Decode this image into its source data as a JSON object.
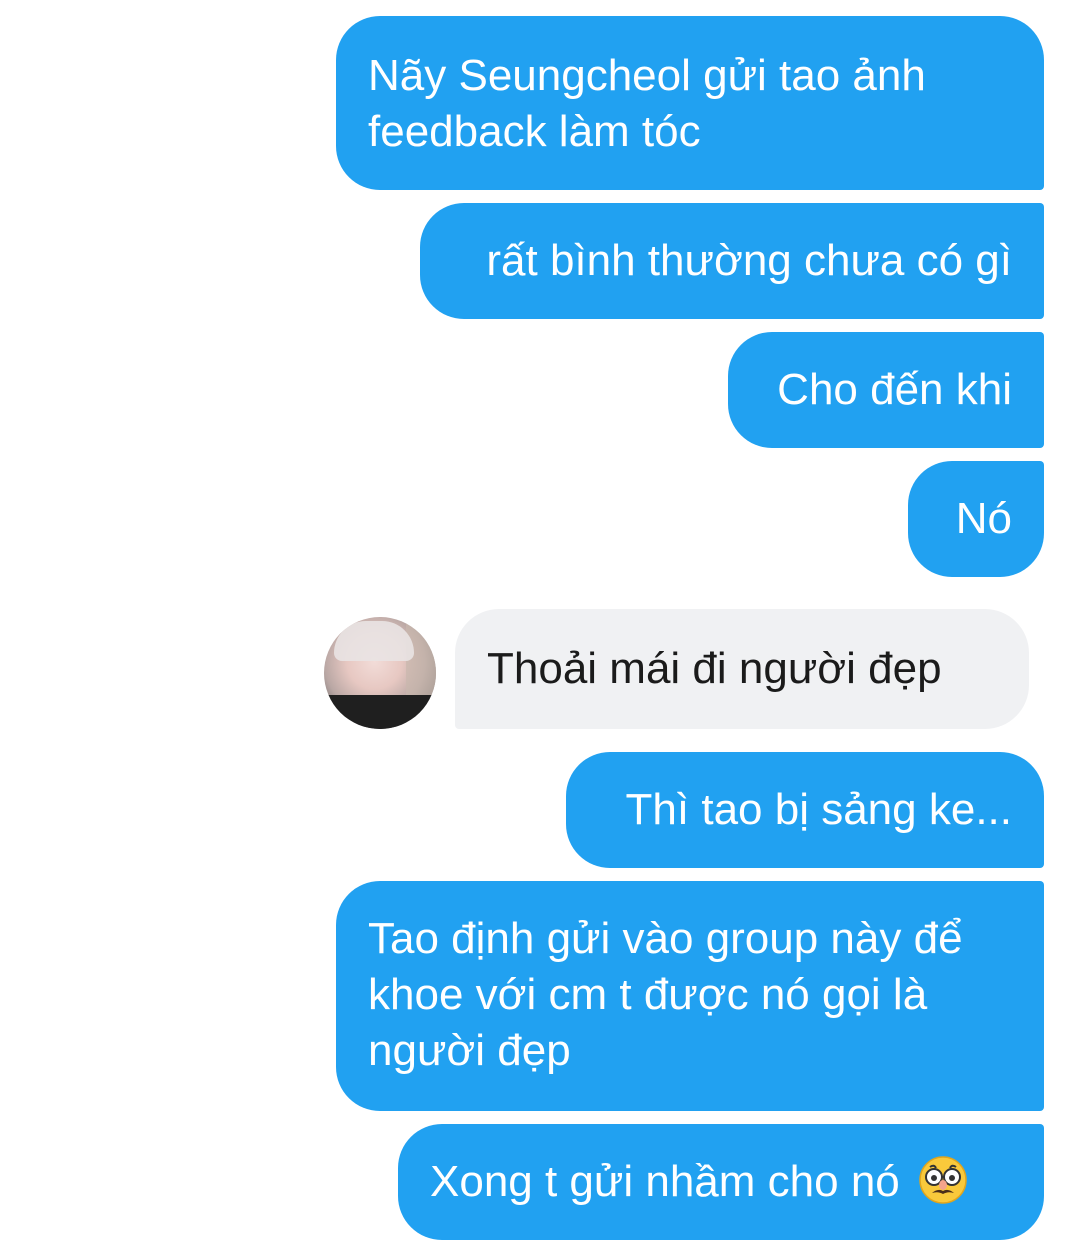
{
  "messages": [
    {
      "id": "m1",
      "direction": "outgoing",
      "text": "Nãy Seungcheol gửi tao ảnh\nfeedback làm tóc"
    },
    {
      "id": "m2",
      "direction": "outgoing",
      "text": "rất bình thường chưa có gì"
    },
    {
      "id": "m3",
      "direction": "outgoing",
      "text": "Cho đến khi"
    },
    {
      "id": "m4",
      "direction": "outgoing",
      "text": "Nó"
    },
    {
      "id": "m5",
      "direction": "incoming",
      "text": "Thoải mái đi người đẹp",
      "sender_avatar": "avatar"
    },
    {
      "id": "m6",
      "direction": "outgoing",
      "text": "Thì tao bị sảng ke..."
    },
    {
      "id": "m7",
      "direction": "outgoing",
      "text": "Tao định gửi vào group này để\nkhoe với cm t được nó gọi là\nngười đẹp"
    },
    {
      "id": "m8",
      "direction": "outgoing",
      "text": "Xong t gửi nhầm cho nó",
      "emoji": "disguised-face-emoji"
    }
  ],
  "colors": {
    "outgoing_bubble": "#21a1f1",
    "incoming_bubble": "#f0f1f3",
    "outgoing_text": "#ffffff",
    "incoming_text": "#1b1b1b"
  }
}
